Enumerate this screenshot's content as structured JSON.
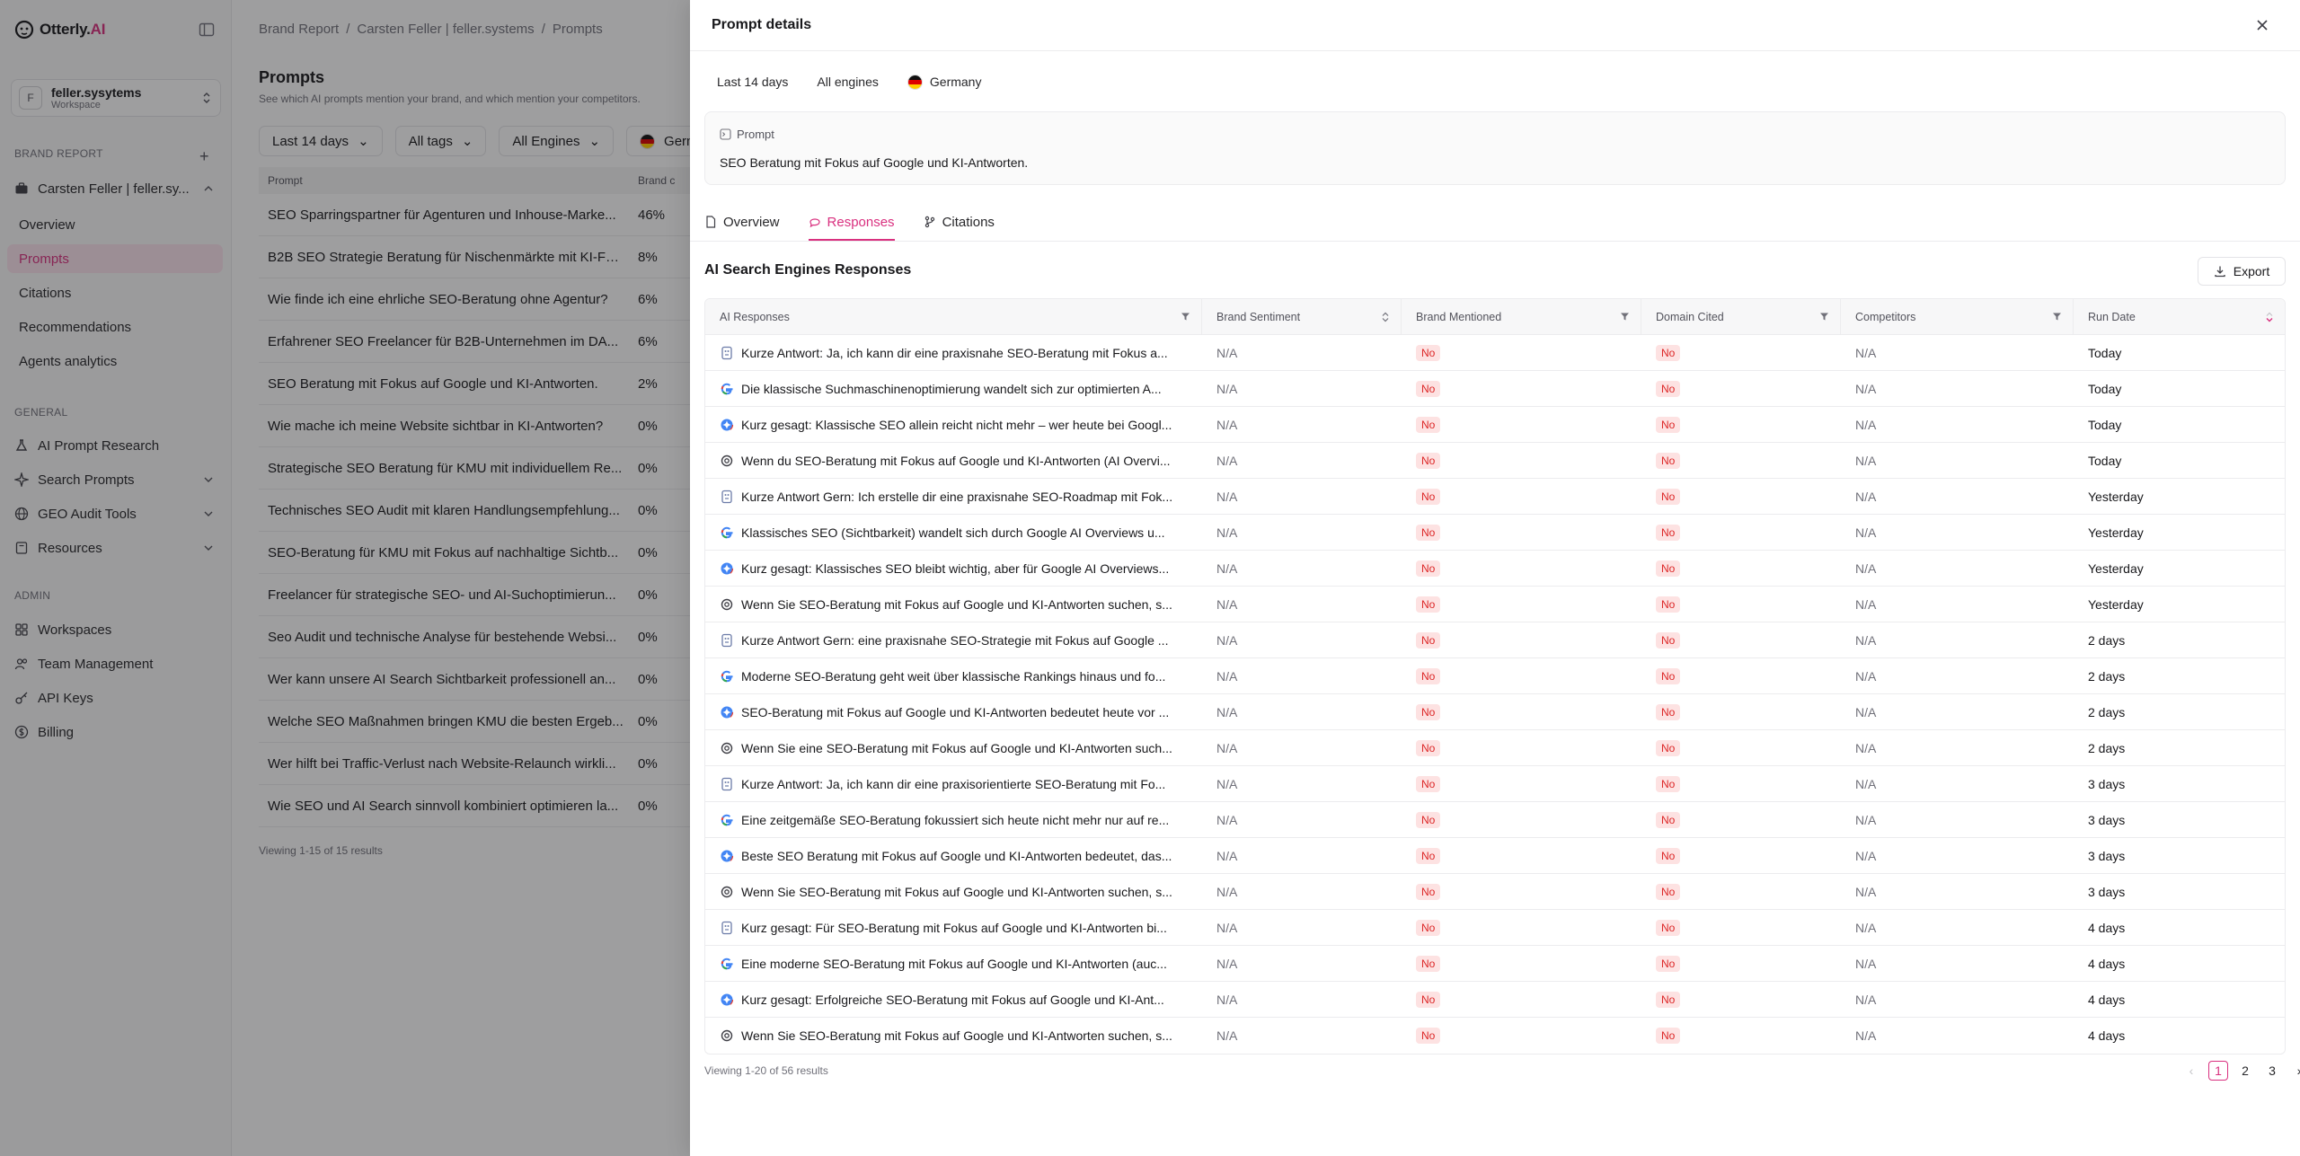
{
  "app": {
    "logo_text": "Otterly.",
    "logo_accent": "AI",
    "brand_color": "#d9307f"
  },
  "sidebar": {
    "workspace": {
      "initial": "F",
      "name": "feller.sysytems",
      "label": "Workspace"
    },
    "brand_report_label": "BRAND REPORT",
    "brand_name": "Carsten Feller | feller.sy...",
    "brand_items": [
      {
        "label": "Overview"
      },
      {
        "label": "Prompts"
      },
      {
        "label": "Citations"
      },
      {
        "label": "Recommendations"
      },
      {
        "label": "Agents analytics"
      }
    ],
    "general_label": "GENERAL",
    "general_items": [
      {
        "label": "AI Prompt Research",
        "icon": "flask-icon"
      },
      {
        "label": "Search Prompts",
        "icon": "sparkle-icon"
      },
      {
        "label": "GEO Audit Tools",
        "icon": "globe-icon"
      },
      {
        "label": "Resources",
        "icon": "book-icon"
      }
    ],
    "admin_label": "ADMIN",
    "admin_items": [
      {
        "label": "Workspaces",
        "icon": "grid-icon"
      },
      {
        "label": "Team Management",
        "icon": "users-icon"
      },
      {
        "label": "API Keys",
        "icon": "key-icon"
      },
      {
        "label": "Billing",
        "icon": "dollar-icon"
      }
    ]
  },
  "main": {
    "breadcrumb": [
      "Brand Report",
      "/",
      "Carsten Feller | feller.systems",
      "/",
      "Prompts"
    ],
    "title": "Prompts",
    "subtitle": "See which AI prompts mention your brand, and which mention your competitors.",
    "filters": [
      "Last 14 days",
      "All tags",
      "All Engines",
      "Germ"
    ],
    "table_head": {
      "prompt": "Prompt",
      "brand": "Brand c"
    },
    "rows": [
      {
        "prompt": "SEO Sparringspartner für Agenturen und Inhouse-Marke...",
        "value": "46%"
      },
      {
        "prompt": "B2B SEO Strategie Beratung für Nischenmärkte mit KI-Fo...",
        "value": "8%"
      },
      {
        "prompt": "Wie finde ich eine ehrliche SEO-Beratung ohne Agentur?",
        "value": "6%"
      },
      {
        "prompt": "Erfahrener SEO Freelancer für B2B-Unternehmen im DA...",
        "value": "6%"
      },
      {
        "prompt": "SEO Beratung mit Fokus auf Google und KI-Antworten.",
        "value": "2%"
      },
      {
        "prompt": "Wie mache ich meine Website sichtbar in KI-Antworten?",
        "value": "0%"
      },
      {
        "prompt": "Strategische SEO Beratung für KMU mit individuellem Re...",
        "value": "0%"
      },
      {
        "prompt": "Technisches SEO Audit mit klaren Handlungsempfehlung...",
        "value": "0%"
      },
      {
        "prompt": "SEO-Beratung für KMU mit Fokus auf nachhaltige Sichtb...",
        "value": "0%"
      },
      {
        "prompt": "Freelancer für strategische SEO- und AI-Suchoptimierun...",
        "value": "0%"
      },
      {
        "prompt": "Seo Audit und technische Analyse für bestehende Websi...",
        "value": "0%"
      },
      {
        "prompt": "Wer kann unsere AI Search Sichtbarkeit professionell an...",
        "value": "0%"
      },
      {
        "prompt": "Welche SEO Maßnahmen bringen KMU die besten Ergeb...",
        "value": "0%"
      },
      {
        "prompt": "Wer hilft bei Traffic-Verlust nach Website-Relaunch wirkli...",
        "value": "0%"
      },
      {
        "prompt": "Wie SEO und AI Search sinnvoll kombiniert optimieren la...",
        "value": "0%"
      }
    ],
    "footer": "Viewing 1-15 of 15 results"
  },
  "drawer": {
    "title": "Prompt details",
    "chips": {
      "period": "Last 14 days",
      "engines": "All engines",
      "country": "Germany"
    },
    "prompt_label": "Prompt",
    "prompt_text": "SEO Beratung mit Fokus auf Google und KI-Antworten.",
    "tabs": [
      "Overview",
      "Responses",
      "Citations"
    ],
    "section_title": "AI Search Engines Responses",
    "export_label": "Export",
    "columns": [
      "AI Responses",
      "Brand Sentiment",
      "Brand Mentioned",
      "Domain Cited",
      "Competitors",
      "Run Date"
    ],
    "responses": [
      {
        "engine": "copilot-icon",
        "text": "Kurze Antwort: Ja, ich kann dir eine praxisnahe SEO-Beratung mit Fokus a...",
        "sentiment": "N/A",
        "mentioned": "No",
        "cited": "No",
        "competitors": "N/A",
        "date": "Today"
      },
      {
        "engine": "google-icon",
        "text": "Die klassische Suchmaschinenoptimierung wandelt sich zur optimierten A...",
        "sentiment": "N/A",
        "mentioned": "No",
        "cited": "No",
        "competitors": "N/A",
        "date": "Today"
      },
      {
        "engine": "gemini-icon",
        "text": "Kurz gesagt: Klassische SEO allein reicht nicht mehr – wer heute bei Googl...",
        "sentiment": "N/A",
        "mentioned": "No",
        "cited": "No",
        "competitors": "N/A",
        "date": "Today"
      },
      {
        "engine": "chatgpt-icon",
        "text": "Wenn du SEO-Beratung mit Fokus auf Google und KI-Antworten (AI Overvi...",
        "sentiment": "N/A",
        "mentioned": "No",
        "cited": "No",
        "competitors": "N/A",
        "date": "Today"
      },
      {
        "engine": "copilot-icon",
        "text": "Kurze Antwort Gern: Ich erstelle dir eine praxisnahe SEO-Roadmap mit Fok...",
        "sentiment": "N/A",
        "mentioned": "No",
        "cited": "No",
        "competitors": "N/A",
        "date": "Yesterday"
      },
      {
        "engine": "google-icon",
        "text": "Klassisches SEO (Sichtbarkeit) wandelt sich durch Google AI Overviews u...",
        "sentiment": "N/A",
        "mentioned": "No",
        "cited": "No",
        "competitors": "N/A",
        "date": "Yesterday"
      },
      {
        "engine": "gemini-icon",
        "text": "Kurz gesagt: Klassisches SEO bleibt wichtig, aber für Google AI Overviews...",
        "sentiment": "N/A",
        "mentioned": "No",
        "cited": "No",
        "competitors": "N/A",
        "date": "Yesterday"
      },
      {
        "engine": "chatgpt-icon",
        "text": "Wenn Sie SEO-Beratung mit Fokus auf Google und KI-Antworten suchen, s...",
        "sentiment": "N/A",
        "mentioned": "No",
        "cited": "No",
        "competitors": "N/A",
        "date": "Yesterday"
      },
      {
        "engine": "copilot-icon",
        "text": "Kurze Antwort Gern: eine praxisnahe SEO-Strategie mit Fokus auf Google ...",
        "sentiment": "N/A",
        "mentioned": "No",
        "cited": "No",
        "competitors": "N/A",
        "date": "2 days"
      },
      {
        "engine": "google-icon",
        "text": "Moderne SEO-Beratung geht weit über klassische Rankings hinaus und fo...",
        "sentiment": "N/A",
        "mentioned": "No",
        "cited": "No",
        "competitors": "N/A",
        "date": "2 days"
      },
      {
        "engine": "gemini-icon",
        "text": "SEO-Beratung mit Fokus auf Google und KI-Antworten bedeutet heute vor ...",
        "sentiment": "N/A",
        "mentioned": "No",
        "cited": "No",
        "competitors": "N/A",
        "date": "2 days"
      },
      {
        "engine": "chatgpt-icon",
        "text": "Wenn Sie eine SEO-Beratung mit Fokus auf Google und KI-Antworten such...",
        "sentiment": "N/A",
        "mentioned": "No",
        "cited": "No",
        "competitors": "N/A",
        "date": "2 days"
      },
      {
        "engine": "copilot-icon",
        "text": "Kurze Antwort: Ja, ich kann dir eine praxisorientierte SEO-Beratung mit Fo...",
        "sentiment": "N/A",
        "mentioned": "No",
        "cited": "No",
        "competitors": "N/A",
        "date": "3 days"
      },
      {
        "engine": "google-icon",
        "text": "Eine zeitgemäße SEO-Beratung fokussiert sich heute nicht mehr nur auf re...",
        "sentiment": "N/A",
        "mentioned": "No",
        "cited": "No",
        "competitors": "N/A",
        "date": "3 days"
      },
      {
        "engine": "gemini-icon",
        "text": "Beste SEO Beratung mit Fokus auf Google und KI-Antworten bedeutet, das...",
        "sentiment": "N/A",
        "mentioned": "No",
        "cited": "No",
        "competitors": "N/A",
        "date": "3 days"
      },
      {
        "engine": "chatgpt-icon",
        "text": "Wenn Sie SEO-Beratung mit Fokus auf Google und KI-Antworten suchen, s...",
        "sentiment": "N/A",
        "mentioned": "No",
        "cited": "No",
        "competitors": "N/A",
        "date": "3 days"
      },
      {
        "engine": "copilot-icon",
        "text": "Kurz gesagt: Für SEO-Beratung mit Fokus auf Google und KI-Antworten bi...",
        "sentiment": "N/A",
        "mentioned": "No",
        "cited": "No",
        "competitors": "N/A",
        "date": "4 days"
      },
      {
        "engine": "google-icon",
        "text": "Eine moderne SEO-Beratung mit Fokus auf Google und KI-Antworten (auc...",
        "sentiment": "N/A",
        "mentioned": "No",
        "cited": "No",
        "competitors": "N/A",
        "date": "4 days"
      },
      {
        "engine": "gemini-icon",
        "text": "Kurz gesagt: Erfolgreiche SEO-Beratung mit Fokus auf Google und KI-Ant...",
        "sentiment": "N/A",
        "mentioned": "No",
        "cited": "No",
        "competitors": "N/A",
        "date": "4 days"
      },
      {
        "engine": "chatgpt-icon",
        "text": "Wenn Sie SEO-Beratung mit Fokus auf Google und KI-Antworten suchen, s...",
        "sentiment": "N/A",
        "mentioned": "No",
        "cited": "No",
        "competitors": "N/A",
        "date": "4 days"
      }
    ],
    "footer": "Viewing 1-20 of 56 results",
    "pages": [
      "1",
      "2",
      "3"
    ],
    "current_page": "1"
  }
}
